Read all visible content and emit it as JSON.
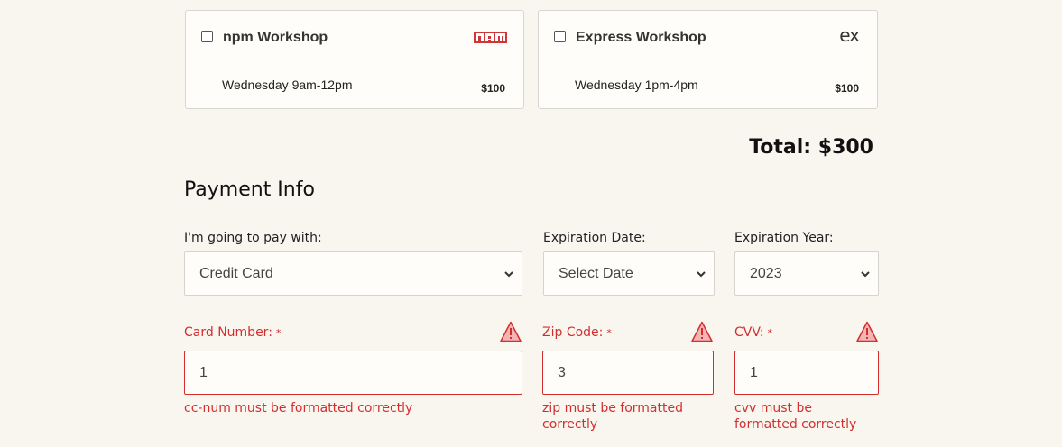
{
  "workshops": [
    {
      "title": "npm Workshop",
      "schedule": "Wednesday 9am-12pm",
      "price": "$100",
      "logo": "npm-logo",
      "logo_text": "npm",
      "checked": false
    },
    {
      "title": "Express Workshop",
      "schedule": "Wednesday 1pm-4pm",
      "price": "$100",
      "logo": "express-logo",
      "logo_text": "ex",
      "checked": false
    }
  ],
  "total": "Total: $300",
  "payment": {
    "heading": "Payment Info",
    "pay_with": {
      "label": "I'm going to pay with:",
      "value": "Credit Card"
    },
    "exp_date": {
      "label": "Expiration Date:",
      "value": "Select Date"
    },
    "exp_year": {
      "label": "Expiration Year:",
      "value": "2023"
    },
    "card_number": {
      "label": "Card Number:",
      "required_mark": "*",
      "value": "1",
      "error": "cc-num must be formatted correctly"
    },
    "zip": {
      "label": "Zip Code:",
      "required_mark": "*",
      "value": "3",
      "error_line1": "zip must be formatted",
      "error_line2": "correctly"
    },
    "cvv": {
      "label": "CVV:",
      "required_mark": "*",
      "value": "1",
      "error_line1": "cvv must be",
      "error_line2": "formatted correctly"
    }
  },
  "colors": {
    "error": "#d32f2f",
    "background": "#f9f5ef",
    "npm_brand": "#cb3837"
  }
}
